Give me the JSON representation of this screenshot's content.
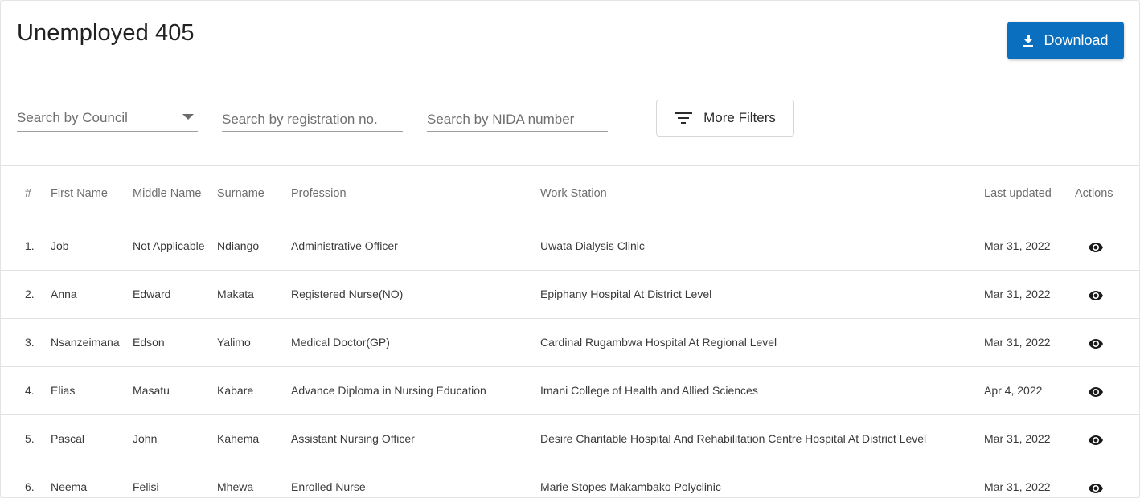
{
  "page": {
    "title": "Unemployed 405",
    "download_label": "Download",
    "more_filters_label": "More Filters"
  },
  "search": {
    "council_placeholder": "Search by Council",
    "registration_placeholder": "Search by registration no.",
    "nida_placeholder": "Search by NIDA number"
  },
  "table": {
    "headers": [
      "#",
      "First Name",
      "Middle Name",
      "Surname",
      "Profession",
      "Work Station",
      "Last updated",
      "Actions"
    ],
    "rows": [
      {
        "num": "1.",
        "first": "Job",
        "middle": "Not Applicable",
        "surname": "Ndiango",
        "profession": "Administrative Officer",
        "station": "Uwata Dialysis Clinic",
        "updated": "Mar 31, 2022"
      },
      {
        "num": "2.",
        "first": "Anna",
        "middle": "Edward",
        "surname": "Makata",
        "profession": "Registered Nurse(NO)",
        "station": "Epiphany Hospital At District Level",
        "updated": "Mar 31, 2022"
      },
      {
        "num": "3.",
        "first": "Nsanzeimana",
        "middle": "Edson",
        "surname": "Yalimo",
        "profession": "Medical Doctor(GP)",
        "station": "Cardinal Rugambwa Hospital At Regional Level",
        "updated": "Mar 31, 2022"
      },
      {
        "num": "4.",
        "first": "Elias",
        "middle": "Masatu",
        "surname": "Kabare",
        "profession": "Advance Diploma in Nursing Education",
        "station": "Imani College of Health and Allied Sciences",
        "updated": "Apr 4, 2022"
      },
      {
        "num": "5.",
        "first": "Pascal",
        "middle": "John",
        "surname": "Kahema",
        "profession": "Assistant Nursing Officer",
        "station": "Desire Charitable Hospital And Rehabilitation Centre Hospital At District Level",
        "updated": "Mar 31, 2022"
      },
      {
        "num": "6.",
        "first": "Neema",
        "middle": "Felisi",
        "surname": "Mhewa",
        "profession": "Enrolled Nurse",
        "station": "Marie Stopes Makambako Polyclinic",
        "updated": "Mar 31, 2022"
      }
    ]
  },
  "icons": {
    "download": "download-icon",
    "filter": "filter-list-icon",
    "view": "eye-icon",
    "dropdown": "caret-down-icon"
  },
  "colors": {
    "primary": "#0b6fbf",
    "text": "#3a3a3a",
    "muted": "#6d6d6d",
    "divider": "#e2e2e2"
  }
}
